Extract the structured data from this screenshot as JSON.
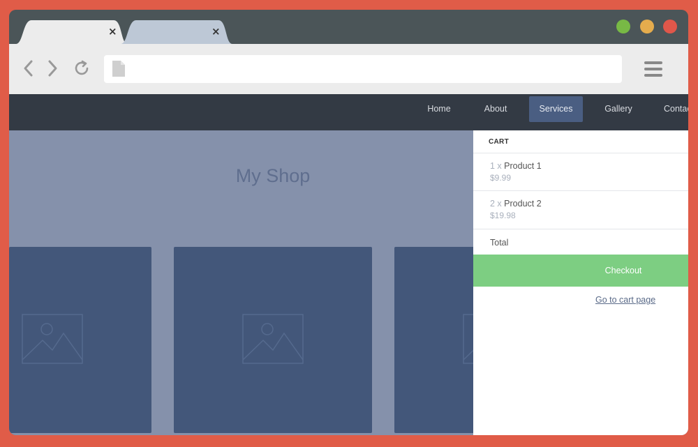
{
  "browser": {
    "tabs": [
      {
        "close_glyph": "×",
        "active": true
      },
      {
        "close_glyph": "×",
        "active": false
      }
    ],
    "window_controls": {
      "colors": {
        "green": "#78b945",
        "yellow": "#e5ac4d",
        "red": "#e0574a"
      }
    },
    "toolbar": {
      "back_icon": "chevron-left-icon",
      "forward_icon": "chevron-right-icon",
      "reload_icon": "reload-icon",
      "page_icon": "document-icon",
      "menu_icon": "hamburger-menu-icon",
      "url_value": ""
    }
  },
  "site": {
    "nav": {
      "items": [
        {
          "label": "Home"
        },
        {
          "label": "About"
        },
        {
          "label": "Services"
        },
        {
          "label": "Gallery"
        },
        {
          "label": "Contact"
        }
      ],
      "active": "Services"
    },
    "hero_title": "My Shop",
    "product_image_icon": "image-placeholder-icon"
  },
  "cart": {
    "header": "CART",
    "items": [
      {
        "qty": "1 x",
        "name": "Product 1",
        "price": "$9.99"
      },
      {
        "qty": "2 x",
        "name": "Product 2",
        "price": "$19.98"
      }
    ],
    "total_label": "Total",
    "checkout_label": "Checkout",
    "cart_page_link": "Go to cart page"
  },
  "colors": {
    "page_background": "#e05c48",
    "nav_background": "#333a44",
    "nav_active": "#4a5e82",
    "content_background": "#8591ab",
    "card": "#43577a",
    "checkout_button": "#7dce82"
  }
}
